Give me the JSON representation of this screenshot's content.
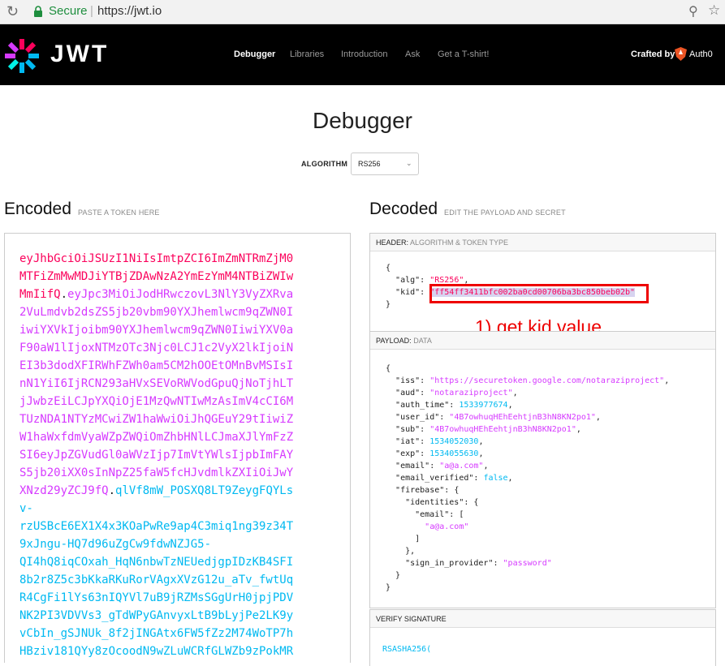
{
  "browser": {
    "secure_label": "Secure",
    "separator": "|",
    "url": "https://jwt.io"
  },
  "nav": {
    "logo_text": "JWT",
    "links": [
      "Debugger",
      "Libraries",
      "Introduction",
      "Ask",
      "Get a T-shirt!"
    ],
    "active": "Debugger",
    "crafted_by": "Crafted by",
    "auth0": "Auth0"
  },
  "title": "Debugger",
  "algorithm": {
    "label": "ALGORITHM",
    "value": "RS256"
  },
  "encoded": {
    "heading": "Encoded",
    "subheading": "PASTE A TOKEN HERE",
    "lines": [
      [
        {
          "t": "eyJhbGciOiJSUzI1NiIsImtpZCI6ImZmNTRmZjM0",
          "c": "red"
        }
      ],
      [
        {
          "t": "MTFiZmMwMDJiYTBjZDAwNzA2YmEzYmM4NTBiZWIw",
          "c": "red"
        }
      ],
      [
        {
          "t": "MmIifQ",
          "c": "red"
        },
        {
          "t": ".",
          "c": "dark"
        },
        {
          "t": "eyJpc3MiOiJodHRwczovL3NlY3VyZXRva",
          "c": "purple"
        }
      ],
      [
        {
          "t": "2VuLmdvb2dsZS5jb20vbm90YXJhemlwcm9qZWN0I",
          "c": "purple"
        }
      ],
      [
        {
          "t": "iwiYXVkIjoibm90YXJhemlwcm9qZWN0IiwiYXV0a",
          "c": "purple"
        }
      ],
      [
        {
          "t": "F90aW1lIjoxNTMzOTc3Njc0LCJ1c2VyX2lkIjoiN",
          "c": "purple"
        }
      ],
      [
        {
          "t": "EI3b3dodXFIRWhFZWh0am5CM2hOOEtOMnBvMSIsI",
          "c": "purple"
        }
      ],
      [
        {
          "t": "nN1YiI6IjRCN293aHVxSEVoRWVodGpuQjNoTjhLT",
          "c": "purple"
        }
      ],
      [
        {
          "t": "jJwbzEiLCJpYXQiOjE1MzQwNTIwMzAsImV4cCI6M",
          "c": "purple"
        }
      ],
      [
        {
          "t": "TUzNDA1NTYzMCwiZW1haWwiOiJhQGEuY29tIiwiZ",
          "c": "purple"
        }
      ],
      [
        {
          "t": "W1haWxfdmVyaWZpZWQiOmZhbHNlLCJmaXJlYmFzZ",
          "c": "purple"
        }
      ],
      [
        {
          "t": "SI6eyJpZGVudGl0aWVzIjp7ImVtYWlsIjpbImFAY",
          "c": "purple"
        }
      ],
      [
        {
          "t": "S5jb20iXX0sInNpZ25faW5fcHJvdmlkZXIiOiJwY",
          "c": "purple"
        }
      ],
      [
        {
          "t": "XNzd29yZCJ9fQ",
          "c": "purple"
        },
        {
          "t": ".",
          "c": "dark"
        },
        {
          "t": "qlVf8mW_POSXQ8LT9ZeygFQYLs",
          "c": "blue"
        }
      ],
      [
        {
          "t": "v-",
          "c": "blue"
        }
      ],
      [
        {
          "t": "rzUSBcE6EX1X4x3KOaPwRe9ap4C3miq1ng39z34T",
          "c": "blue"
        }
      ],
      [
        {
          "t": "9xJngu-HQ7d96uZgCw9fdwNZJG5-",
          "c": "blue"
        }
      ],
      [
        {
          "t": "QI4hQ8iqCOxah_HqN6nbwTzNEUedjgpIDzKB4SFI",
          "c": "blue"
        }
      ],
      [
        {
          "t": "8b2r8Z5c3bKkaRKuRorVAgxXVzG12u_aTv_fwtUq",
          "c": "blue"
        }
      ],
      [
        {
          "t": "R4CgFi1lYs63nIQYVl7uB9jRZMsSGgUrH0jpjPDV",
          "c": "blue"
        }
      ],
      [
        {
          "t": "NK2PI3VDVVs3_gTdWPyGAnvyxLtB9bLyjPe2LK9y",
          "c": "blue"
        }
      ],
      [
        {
          "t": "vCbIn_gSJNUk_8f2jINGAtx6FW5fZz2M74WoTP7h",
          "c": "blue"
        }
      ],
      [
        {
          "t": "HBziv181QYy8zOcoodN9wZLuWCRfGLWZb9zPokMR",
          "c": "blue"
        }
      ]
    ]
  },
  "decoded": {
    "heading": "Decoded",
    "subheading": "EDIT THE PAYLOAD AND SECRET",
    "header_label": "HEADER:",
    "header_sub": "ALGORITHM & TOKEN TYPE",
    "header_lines": [
      "{",
      "  \"alg\": \"RS256\",",
      "  \"kid\": \"ff54ff3411bfc002ba0cd00706ba3bc850beb02b\"",
      "}"
    ],
    "payload_label": "PAYLOAD:",
    "payload_sub": "DATA",
    "payload_lines": [
      "{",
      "  \"iss\": \"https://securetoken.google.com/notaraziproject\",",
      "  \"aud\": \"notaraziproject\",",
      "  \"auth_time\": 1533977674,",
      "  \"user_id\": \"4B7owhuqHEhEehtjnB3hN8KN2po1\",",
      "  \"sub\": \"4B7owhuqHEhEehtjnB3hN8KN2po1\",",
      "  \"iat\": 1534052030,",
      "  \"exp\": 1534055630,",
      "  \"email\": \"a@a.com\",",
      "  \"email_verified\": false,",
      "  \"firebase\": {",
      "    \"identities\": {",
      "      \"email\": [",
      "        \"a@a.com\"",
      "      ]",
      "    },",
      "    \"sign_in_provider\": \"password\"",
      "  }",
      "}"
    ],
    "verify_label": "VERIFY SIGNATURE",
    "verify_first": "RSASHA256("
  },
  "annotation": "1) get kid value",
  "colors": {
    "header": "#fb015b",
    "payload": "#d63aff",
    "signature": "#00b9f1",
    "annotation": "#e00000"
  }
}
